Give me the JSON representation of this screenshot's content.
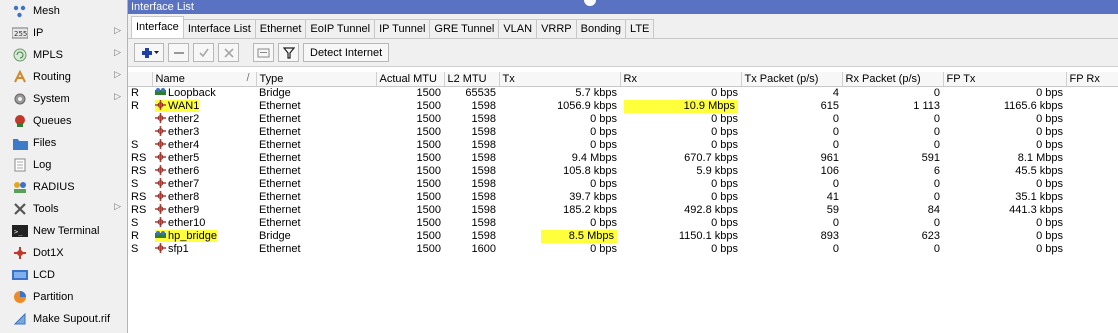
{
  "sidebar": {
    "items": [
      {
        "label": "Mesh",
        "icon": "mesh-icon",
        "arrow": false
      },
      {
        "label": "IP",
        "icon": "ip-icon",
        "arrow": true
      },
      {
        "label": "MPLS",
        "icon": "mpls-icon",
        "arrow": true
      },
      {
        "label": "Routing",
        "icon": "routing-icon",
        "arrow": true
      },
      {
        "label": "System",
        "icon": "system-icon",
        "arrow": true
      },
      {
        "label": "Queues",
        "icon": "queues-icon",
        "arrow": false
      },
      {
        "label": "Files",
        "icon": "files-icon",
        "arrow": false
      },
      {
        "label": "Log",
        "icon": "log-icon",
        "arrow": false
      },
      {
        "label": "RADIUS",
        "icon": "radius-icon",
        "arrow": false
      },
      {
        "label": "Tools",
        "icon": "tools-icon",
        "arrow": true
      },
      {
        "label": "New Terminal",
        "icon": "terminal-icon",
        "arrow": false
      },
      {
        "label": "Dot1X",
        "icon": "dot1x-icon",
        "arrow": false
      },
      {
        "label": "LCD",
        "icon": "lcd-icon",
        "arrow": false
      },
      {
        "label": "Partition",
        "icon": "partition-icon",
        "arrow": false
      },
      {
        "label": "Make Supout.rif",
        "icon": "supout-icon",
        "arrow": false
      }
    ],
    "ip_badge": "255"
  },
  "window": {
    "title": "Interface List"
  },
  "tabs": [
    "Interface",
    "Interface List",
    "Ethernet",
    "EoIP Tunnel",
    "IP Tunnel",
    "GRE Tunnel",
    "VLAN",
    "VRRP",
    "Bonding",
    "LTE"
  ],
  "toolbar": {
    "detect_label": "Detect Internet"
  },
  "table": {
    "columns": [
      "",
      "Name",
      "Type",
      "Actual MTU",
      "L2 MTU",
      "Tx",
      "Rx",
      "Tx Packet (p/s)",
      "Rx Packet (p/s)",
      "FP Tx",
      "FP Rx"
    ],
    "sort_indicator": "/",
    "rows": [
      {
        "flag": "R",
        "name": "Loopback",
        "icon": "bridge",
        "type": "Bridge",
        "mtu": "1500",
        "l2mtu": "65535",
        "tx": "5.7 kbps",
        "rx": "0 bps",
        "txp": "4",
        "rxp": "0",
        "fptx": "0 bps",
        "hl": []
      },
      {
        "flag": "R",
        "name": "WAN1",
        "icon": "ether",
        "type": "Ethernet",
        "mtu": "1500",
        "l2mtu": "1598",
        "tx": "1056.9 kbps",
        "rx": "10.9 Mbps",
        "txp": "615",
        "rxp": "1 113",
        "fptx": "1165.6 kbps",
        "hl": [
          "name",
          "rx"
        ]
      },
      {
        "flag": "",
        "name": "ether2",
        "icon": "ether",
        "type": "Ethernet",
        "mtu": "1500",
        "l2mtu": "1598",
        "tx": "0 bps",
        "rx": "0 bps",
        "txp": "0",
        "rxp": "0",
        "fptx": "0 bps",
        "hl": []
      },
      {
        "flag": "",
        "name": "ether3",
        "icon": "ether",
        "type": "Ethernet",
        "mtu": "1500",
        "l2mtu": "1598",
        "tx": "0 bps",
        "rx": "0 bps",
        "txp": "0",
        "rxp": "0",
        "fptx": "0 bps",
        "hl": []
      },
      {
        "flag": "S",
        "name": "ether4",
        "icon": "ether",
        "type": "Ethernet",
        "mtu": "1500",
        "l2mtu": "1598",
        "tx": "0 bps",
        "rx": "0 bps",
        "txp": "0",
        "rxp": "0",
        "fptx": "0 bps",
        "hl": []
      },
      {
        "flag": "RS",
        "name": "ether5",
        "icon": "ether",
        "type": "Ethernet",
        "mtu": "1500",
        "l2mtu": "1598",
        "tx": "9.4 Mbps",
        "rx": "670.7 kbps",
        "txp": "961",
        "rxp": "591",
        "fptx": "8.1 Mbps",
        "hl": []
      },
      {
        "flag": "RS",
        "name": "ether6",
        "icon": "ether",
        "type": "Ethernet",
        "mtu": "1500",
        "l2mtu": "1598",
        "tx": "105.8 kbps",
        "rx": "5.9 kbps",
        "txp": "106",
        "rxp": "6",
        "fptx": "45.5 kbps",
        "hl": []
      },
      {
        "flag": "S",
        "name": "ether7",
        "icon": "ether",
        "type": "Ethernet",
        "mtu": "1500",
        "l2mtu": "1598",
        "tx": "0 bps",
        "rx": "0 bps",
        "txp": "0",
        "rxp": "0",
        "fptx": "0 bps",
        "hl": []
      },
      {
        "flag": "RS",
        "name": "ether8",
        "icon": "ether",
        "type": "Ethernet",
        "mtu": "1500",
        "l2mtu": "1598",
        "tx": "39.7 kbps",
        "rx": "0 bps",
        "txp": "41",
        "rxp": "0",
        "fptx": "35.1 kbps",
        "hl": []
      },
      {
        "flag": "RS",
        "name": "ether9",
        "icon": "ether",
        "type": "Ethernet",
        "mtu": "1500",
        "l2mtu": "1598",
        "tx": "185.2 kbps",
        "rx": "492.8 kbps",
        "txp": "59",
        "rxp": "84",
        "fptx": "441.3 kbps",
        "hl": []
      },
      {
        "flag": "S",
        "name": "ether10",
        "icon": "ether",
        "type": "Ethernet",
        "mtu": "1500",
        "l2mtu": "1598",
        "tx": "0 bps",
        "rx": "0 bps",
        "txp": "0",
        "rxp": "0",
        "fptx": "0 bps",
        "hl": []
      },
      {
        "flag": "R",
        "name": "hp_bridge",
        "icon": "bridge",
        "type": "Bridge",
        "mtu": "1500",
        "l2mtu": "1598",
        "tx": "8.5 Mbps",
        "rx": "1150.1 kbps",
        "txp": "893",
        "rxp": "623",
        "fptx": "0 bps",
        "hl": [
          "name",
          "tx"
        ]
      },
      {
        "flag": "S",
        "name": "sfp1",
        "icon": "ether",
        "type": "Ethernet",
        "mtu": "1500",
        "l2mtu": "1600",
        "tx": "0 bps",
        "rx": "0 bps",
        "txp": "0",
        "rxp": "0",
        "fptx": "0 bps",
        "hl": []
      }
    ]
  },
  "colors": {
    "titlebar": "#5a72c2",
    "highlight": "#ffff3c"
  }
}
